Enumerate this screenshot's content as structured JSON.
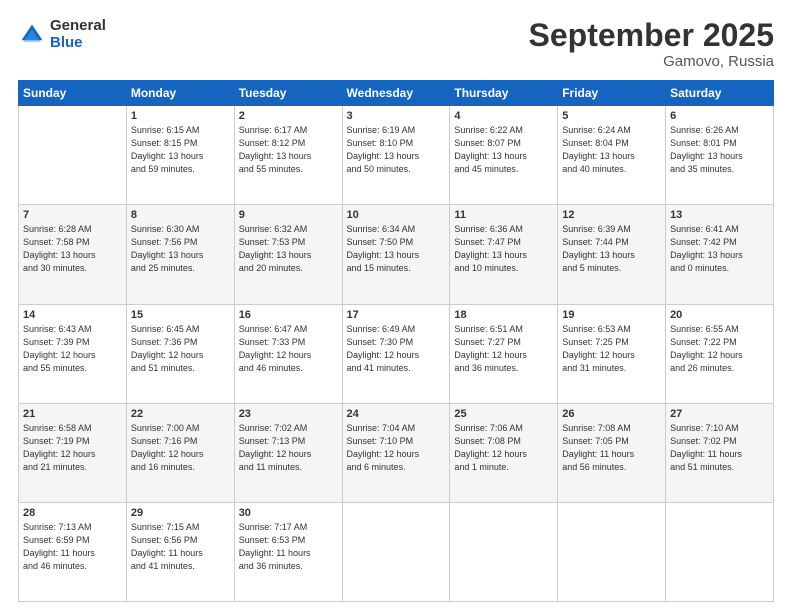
{
  "header": {
    "logo_general": "General",
    "logo_blue": "Blue",
    "title": "September 2025",
    "subtitle": "Gamovo, Russia"
  },
  "columns": [
    "Sunday",
    "Monday",
    "Tuesday",
    "Wednesday",
    "Thursday",
    "Friday",
    "Saturday"
  ],
  "weeks": [
    {
      "days": [
        {
          "num": "",
          "info": ""
        },
        {
          "num": "1",
          "info": "Sunrise: 6:15 AM\nSunset: 8:15 PM\nDaylight: 13 hours\nand 59 minutes."
        },
        {
          "num": "2",
          "info": "Sunrise: 6:17 AM\nSunset: 8:12 PM\nDaylight: 13 hours\nand 55 minutes."
        },
        {
          "num": "3",
          "info": "Sunrise: 6:19 AM\nSunset: 8:10 PM\nDaylight: 13 hours\nand 50 minutes."
        },
        {
          "num": "4",
          "info": "Sunrise: 6:22 AM\nSunset: 8:07 PM\nDaylight: 13 hours\nand 45 minutes."
        },
        {
          "num": "5",
          "info": "Sunrise: 6:24 AM\nSunset: 8:04 PM\nDaylight: 13 hours\nand 40 minutes."
        },
        {
          "num": "6",
          "info": "Sunrise: 6:26 AM\nSunset: 8:01 PM\nDaylight: 13 hours\nand 35 minutes."
        }
      ]
    },
    {
      "days": [
        {
          "num": "7",
          "info": "Sunrise: 6:28 AM\nSunset: 7:58 PM\nDaylight: 13 hours\nand 30 minutes."
        },
        {
          "num": "8",
          "info": "Sunrise: 6:30 AM\nSunset: 7:56 PM\nDaylight: 13 hours\nand 25 minutes."
        },
        {
          "num": "9",
          "info": "Sunrise: 6:32 AM\nSunset: 7:53 PM\nDaylight: 13 hours\nand 20 minutes."
        },
        {
          "num": "10",
          "info": "Sunrise: 6:34 AM\nSunset: 7:50 PM\nDaylight: 13 hours\nand 15 minutes."
        },
        {
          "num": "11",
          "info": "Sunrise: 6:36 AM\nSunset: 7:47 PM\nDaylight: 13 hours\nand 10 minutes."
        },
        {
          "num": "12",
          "info": "Sunrise: 6:39 AM\nSunset: 7:44 PM\nDaylight: 13 hours\nand 5 minutes."
        },
        {
          "num": "13",
          "info": "Sunrise: 6:41 AM\nSunset: 7:42 PM\nDaylight: 13 hours\nand 0 minutes."
        }
      ]
    },
    {
      "days": [
        {
          "num": "14",
          "info": "Sunrise: 6:43 AM\nSunset: 7:39 PM\nDaylight: 12 hours\nand 55 minutes."
        },
        {
          "num": "15",
          "info": "Sunrise: 6:45 AM\nSunset: 7:36 PM\nDaylight: 12 hours\nand 51 minutes."
        },
        {
          "num": "16",
          "info": "Sunrise: 6:47 AM\nSunset: 7:33 PM\nDaylight: 12 hours\nand 46 minutes."
        },
        {
          "num": "17",
          "info": "Sunrise: 6:49 AM\nSunset: 7:30 PM\nDaylight: 12 hours\nand 41 minutes."
        },
        {
          "num": "18",
          "info": "Sunrise: 6:51 AM\nSunset: 7:27 PM\nDaylight: 12 hours\nand 36 minutes."
        },
        {
          "num": "19",
          "info": "Sunrise: 6:53 AM\nSunset: 7:25 PM\nDaylight: 12 hours\nand 31 minutes."
        },
        {
          "num": "20",
          "info": "Sunrise: 6:55 AM\nSunset: 7:22 PM\nDaylight: 12 hours\nand 26 minutes."
        }
      ]
    },
    {
      "days": [
        {
          "num": "21",
          "info": "Sunrise: 6:58 AM\nSunset: 7:19 PM\nDaylight: 12 hours\nand 21 minutes."
        },
        {
          "num": "22",
          "info": "Sunrise: 7:00 AM\nSunset: 7:16 PM\nDaylight: 12 hours\nand 16 minutes."
        },
        {
          "num": "23",
          "info": "Sunrise: 7:02 AM\nSunset: 7:13 PM\nDaylight: 12 hours\nand 11 minutes."
        },
        {
          "num": "24",
          "info": "Sunrise: 7:04 AM\nSunset: 7:10 PM\nDaylight: 12 hours\nand 6 minutes."
        },
        {
          "num": "25",
          "info": "Sunrise: 7:06 AM\nSunset: 7:08 PM\nDaylight: 12 hours\nand 1 minute."
        },
        {
          "num": "26",
          "info": "Sunrise: 7:08 AM\nSunset: 7:05 PM\nDaylight: 11 hours\nand 56 minutes."
        },
        {
          "num": "27",
          "info": "Sunrise: 7:10 AM\nSunset: 7:02 PM\nDaylight: 11 hours\nand 51 minutes."
        }
      ]
    },
    {
      "days": [
        {
          "num": "28",
          "info": "Sunrise: 7:13 AM\nSunset: 6:59 PM\nDaylight: 11 hours\nand 46 minutes."
        },
        {
          "num": "29",
          "info": "Sunrise: 7:15 AM\nSunset: 6:56 PM\nDaylight: 11 hours\nand 41 minutes."
        },
        {
          "num": "30",
          "info": "Sunrise: 7:17 AM\nSunset: 6:53 PM\nDaylight: 11 hours\nand 36 minutes."
        },
        {
          "num": "",
          "info": ""
        },
        {
          "num": "",
          "info": ""
        },
        {
          "num": "",
          "info": ""
        },
        {
          "num": "",
          "info": ""
        }
      ]
    }
  ]
}
